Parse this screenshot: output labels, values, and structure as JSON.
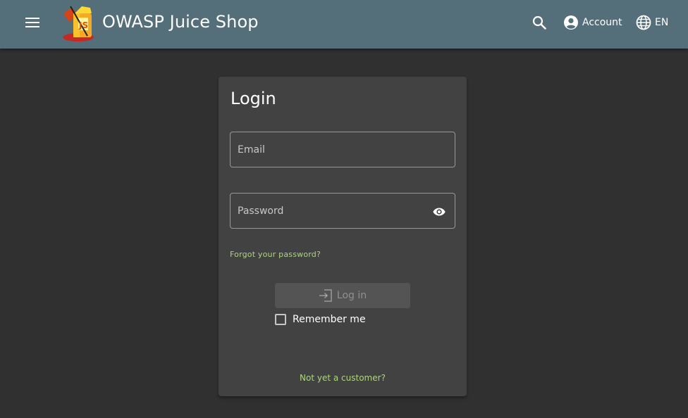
{
  "header": {
    "app_title": "OWASP Juice Shop",
    "account_label": "Account",
    "language_label": "EN",
    "icons": [
      "menu-icon",
      "juice-shop-logo",
      "search-icon",
      "account-circle-icon",
      "language-icon"
    ],
    "background_color": "#546e7a"
  },
  "login": {
    "title": "Login",
    "email_placeholder": "Email",
    "email_value": "",
    "password_placeholder": "Password",
    "password_value": "",
    "forgot_password_label": "Forgot your password?",
    "login_button_label": "Log in",
    "login_button_disabled": true,
    "remember_me_label": "Remember me",
    "remember_me_checked": false,
    "register_label": "Not yet a customer?",
    "link_color": "#aed581",
    "icons": [
      "visibility-icon",
      "login-icon"
    ]
  },
  "theme": {
    "page_background": "#303030",
    "card_background": "#424242"
  }
}
